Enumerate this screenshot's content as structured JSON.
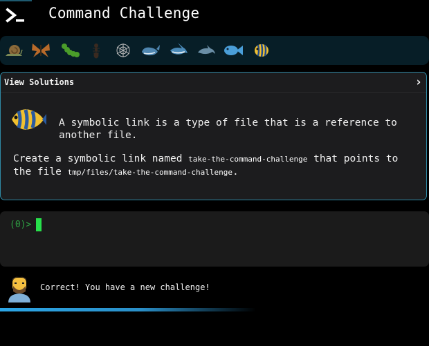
{
  "app": {
    "title": "Command Challenge"
  },
  "levels": {
    "icons": [
      "snail-icon",
      "butterfly-icon",
      "caterpillar-icon",
      "ant-icon",
      "spider-web-icon",
      "whale-icon",
      "shark-icon",
      "dolphin-icon",
      "fish-icon",
      "tropical-fish-icon"
    ]
  },
  "challenge": {
    "view_solutions_label": "View Solutions",
    "intro": "A symbolic link is a type of file that is a reference to another file.",
    "task_prefix": "Create a symbolic link named ",
    "link_name": "take-the-command-challenge",
    "task_middle": " that points to the file ",
    "target_path": "tmp/files/take-the-command-challenge",
    "task_suffix": "."
  },
  "terminal": {
    "prompt": "(0)>"
  },
  "status": {
    "message": "Correct! You have a new challenge!"
  },
  "colors": {
    "accent": "#2f8aa6",
    "prompt": "#2ea043",
    "progress": "#2ca6e6"
  }
}
